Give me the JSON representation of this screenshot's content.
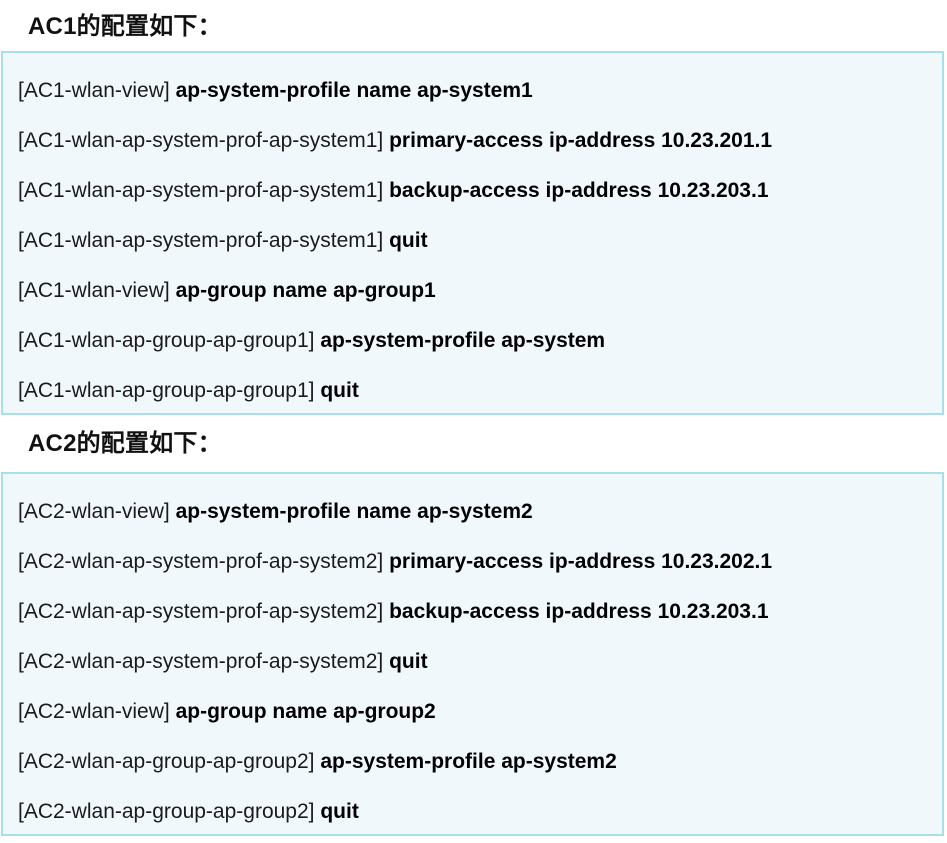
{
  "sections": [
    {
      "heading": "AC1的配置如下：",
      "lines": [
        {
          "prompt": "[AC1-wlan-view]",
          "command": "ap-system-profile name ap-system1"
        },
        {
          "prompt": "[AC1-wlan-ap-system-prof-ap-system1]",
          "command": "primary-access ip-address 10.23.201.1"
        },
        {
          "prompt": "[AC1-wlan-ap-system-prof-ap-system1]",
          "command": "backup-access ip-address 10.23.203.1"
        },
        {
          "prompt": "[AC1-wlan-ap-system-prof-ap-system1]",
          "command": "quit"
        },
        {
          "prompt": "[AC1-wlan-view]",
          "command": "ap-group name ap-group1"
        },
        {
          "prompt": "[AC1-wlan-ap-group-ap-group1]",
          "command": "ap-system-profile ap-system"
        },
        {
          "prompt": "[AC1-wlan-ap-group-ap-group1]",
          "command": "quit"
        }
      ]
    },
    {
      "heading": "AC2的配置如下：",
      "lines": [
        {
          "prompt": "[AC2-wlan-view]",
          "command": "ap-system-profile name ap-system2"
        },
        {
          "prompt": "[AC2-wlan-ap-system-prof-ap-system2]",
          "command": "primary-access ip-address 10.23.202.1"
        },
        {
          "prompt": "[AC2-wlan-ap-system-prof-ap-system2]",
          "command": "backup-access ip-address 10.23.203.1"
        },
        {
          "prompt": "[AC2-wlan-ap-system-prof-ap-system2]",
          "command": "quit"
        },
        {
          "prompt": "[AC2-wlan-view]",
          "command": "ap-group name ap-group2"
        },
        {
          "prompt": "[AC2-wlan-ap-group-ap-group2]",
          "command": "ap-system-profile ap-system2"
        },
        {
          "prompt": "[AC2-wlan-ap-group-ap-group2]",
          "command": "quit"
        }
      ]
    }
  ]
}
